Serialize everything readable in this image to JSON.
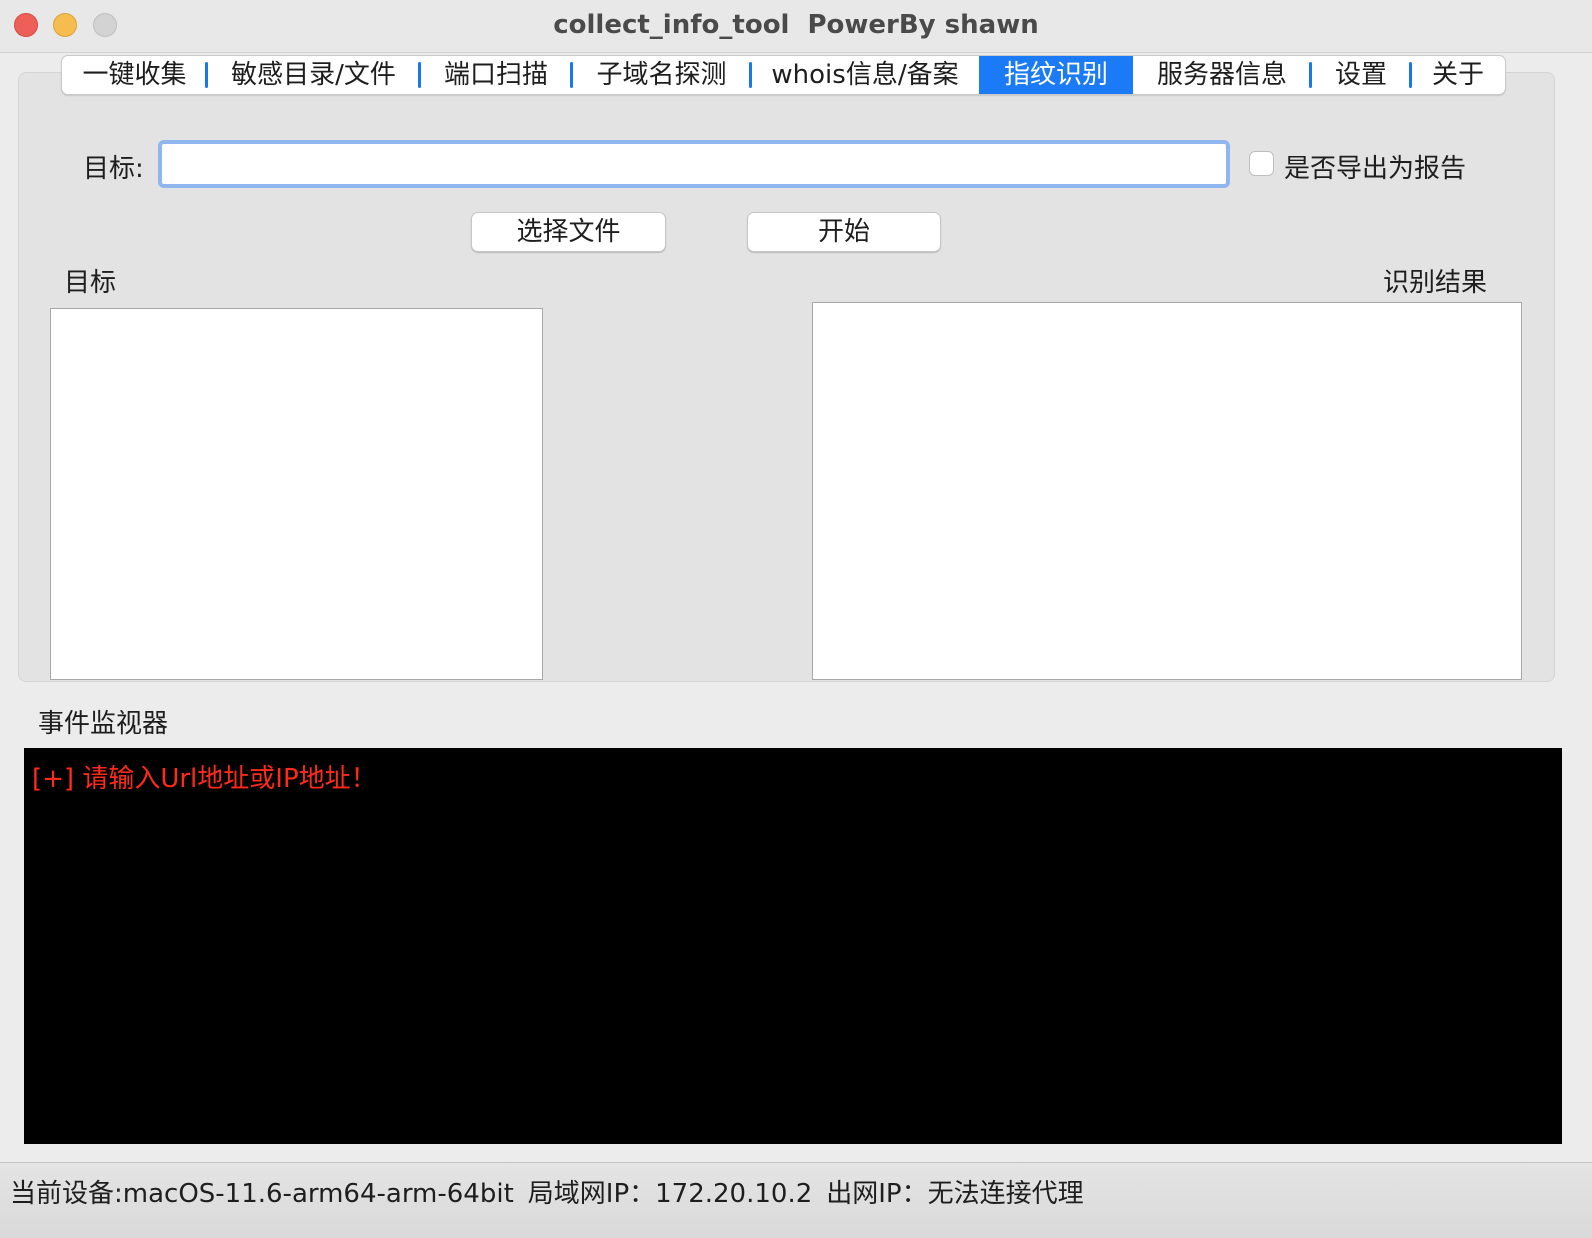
{
  "window": {
    "title_app": "collect_info_tool",
    "title_power": "PowerBy shawn"
  },
  "tabs": [
    {
      "label": "一键收集",
      "active": false
    },
    {
      "label": "敏感目录/文件",
      "active": false
    },
    {
      "label": "端口扫描",
      "active": false
    },
    {
      "label": "子域名探测",
      "active": false
    },
    {
      "label": "whois信息/备案",
      "active": false
    },
    {
      "label": "指纹识别",
      "active": true
    },
    {
      "label": "服务器信息",
      "active": false
    },
    {
      "label": "设置",
      "active": false
    },
    {
      "label": "关于",
      "active": false
    }
  ],
  "form": {
    "target_label": "目标:",
    "target_value": "",
    "export_label": "是否导出为报告",
    "export_checked": false,
    "choose_file_button": "选择文件",
    "start_button": "开始"
  },
  "lists": {
    "targets_header": "目标",
    "results_header": "识别结果"
  },
  "monitor": {
    "header": "事件监视器",
    "lines": [
      "[+] 请输入Url地址或IP地址！"
    ],
    "text_color": "#ff2a1a"
  },
  "status": {
    "device": "当前设备:macOS-11.6-arm64-arm-64bit",
    "lan_ip": "局域网IP：172.20.10.2",
    "wan_ip": "出网IP：无法连接代理"
  },
  "colors": {
    "accent": "#1b7bf6",
    "console_bg": "#000000"
  }
}
